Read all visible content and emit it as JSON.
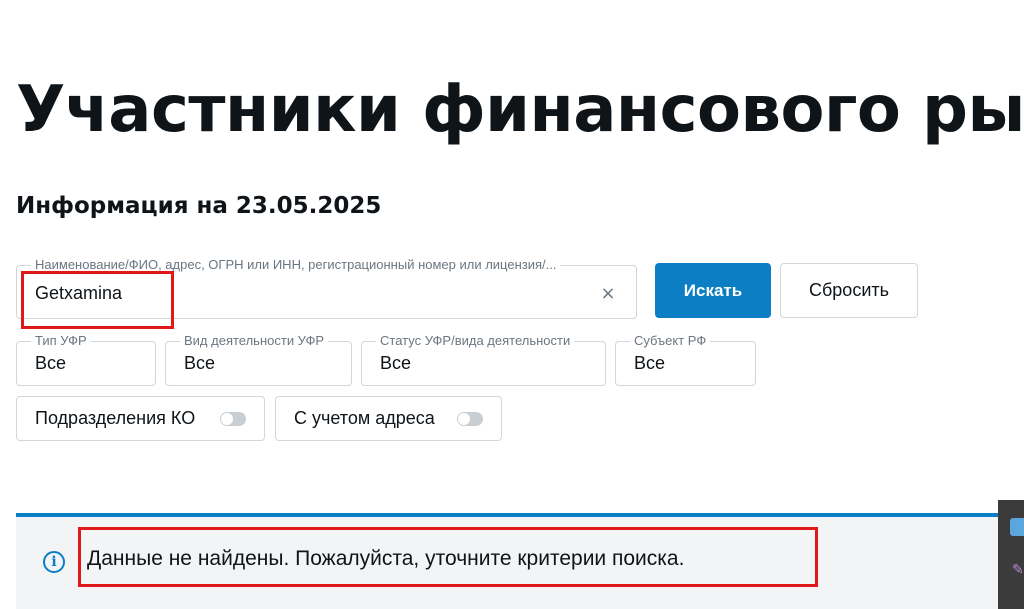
{
  "page": {
    "title": "Участники финансового рынка",
    "info_date": "Информация на 23.05.2025"
  },
  "search": {
    "label": "Наименование/ФИО, адрес, ОГРН или ИНН, регистрационный номер или лицензия/...",
    "value": "Getxamina",
    "clear_symbol": "×",
    "search_button": "Искать",
    "reset_button": "Сбросить"
  },
  "filters": [
    {
      "label": "Тип УФР",
      "value": "Все"
    },
    {
      "label": "Вид деятельности УФР",
      "value": "Все"
    },
    {
      "label": "Статус УФР/вида деятельности",
      "value": "Все"
    },
    {
      "label": "Субъект РФ",
      "value": "Все"
    }
  ],
  "toggles": [
    {
      "label": "Подразделения КО",
      "on": false
    },
    {
      "label": "С учетом адреса",
      "on": false
    }
  ],
  "notice": {
    "icon": "info-icon",
    "icon_glyph": "i",
    "text": "Данные не найдены. Пожалуйста, уточните критерии поиска."
  },
  "colors": {
    "accent": "#0b7ec4",
    "annotation": "#e01818",
    "notice_bg": "#f2f4f6"
  }
}
